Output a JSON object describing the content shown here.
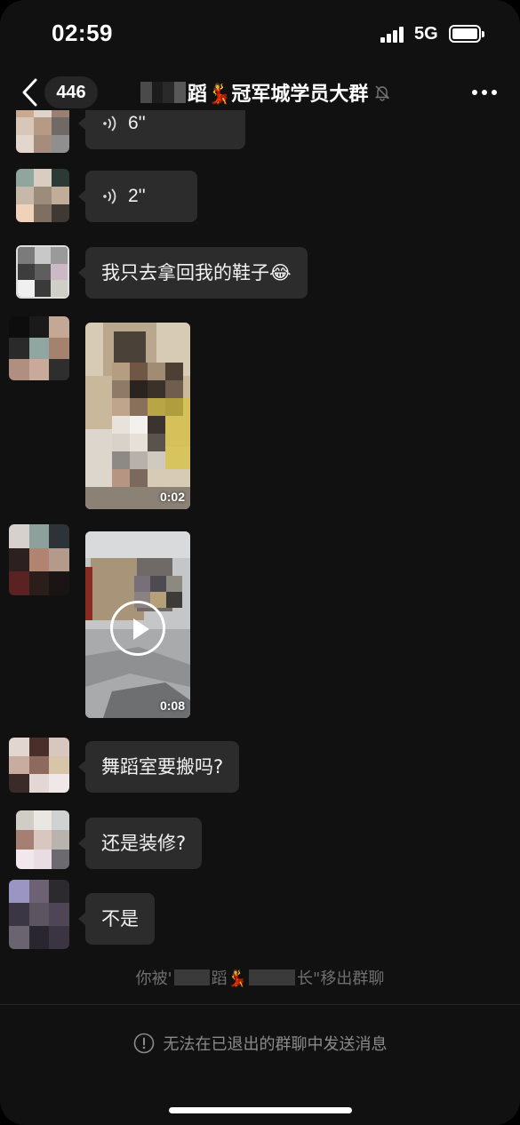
{
  "status_bar": {
    "time": "02:59",
    "network": "5G",
    "battery_level": 1.0
  },
  "nav": {
    "unread_count": "446",
    "group_title": "蹈💃冠军城学员大群"
  },
  "messages": [
    {
      "type": "voice",
      "duration": "6''"
    },
    {
      "type": "voice",
      "duration": "2''"
    },
    {
      "type": "text",
      "text": "我只去拿回我的鞋子😂"
    },
    {
      "type": "video",
      "duration": "0:02"
    },
    {
      "type": "video",
      "duration": "0:08"
    },
    {
      "type": "text",
      "text": "舞蹈室要搬吗?"
    },
    {
      "type": "text",
      "text": "还是装修?"
    },
    {
      "type": "text",
      "text": "不是"
    }
  ],
  "system_note": {
    "prefix": "你被'",
    "middle": "蹈💃",
    "suffix": "长\"移出群聊"
  },
  "footer": {
    "notice": "无法在已退出的群聊中发送消息"
  },
  "colors": {
    "background": "#111111",
    "bubble": "#2c2c2c",
    "muted_text": "#6f6f6f"
  }
}
